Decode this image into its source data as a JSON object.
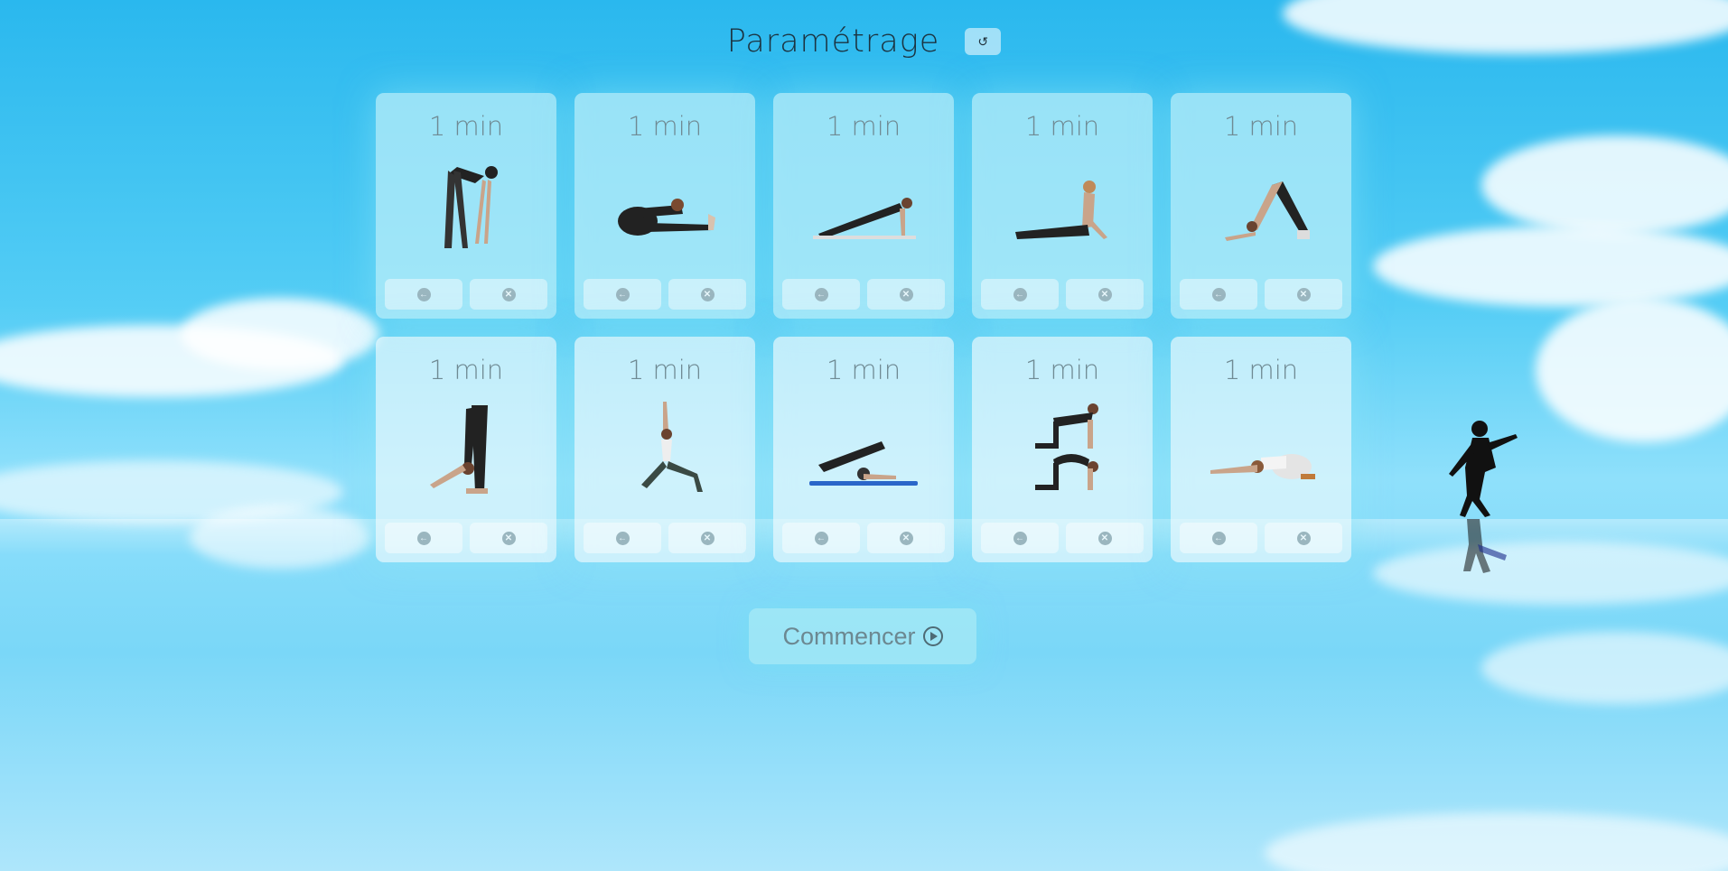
{
  "page": {
    "title": "Paramétrage",
    "reset_icon": "↺",
    "start_label": "Commencer"
  },
  "colors": {
    "sky_top": "#2ab8ee",
    "card_bg": "#bef0fa",
    "title_text": "#1c3340",
    "muted_text": "#6f8a93",
    "icon_gray": "#9ab6bf"
  },
  "cards": [
    {
      "duration": "1 min",
      "pose_icon": "forward-fold-icon"
    },
    {
      "duration": "1 min",
      "pose_icon": "seated-forward-bend-icon"
    },
    {
      "duration": "1 min",
      "pose_icon": "plank-icon"
    },
    {
      "duration": "1 min",
      "pose_icon": "cobra-icon"
    },
    {
      "duration": "1 min",
      "pose_icon": "downward-dog-icon"
    },
    {
      "duration": "1 min",
      "pose_icon": "standing-fold-icon"
    },
    {
      "duration": "1 min",
      "pose_icon": "crescent-lunge-icon"
    },
    {
      "duration": "1 min",
      "pose_icon": "plow-pose-icon"
    },
    {
      "duration": "1 min",
      "pose_icon": "cat-cow-icon"
    },
    {
      "duration": "1 min",
      "pose_icon": "child-pose-icon"
    }
  ],
  "card_buttons": {
    "back_icon": "←",
    "remove_icon": "✕"
  }
}
